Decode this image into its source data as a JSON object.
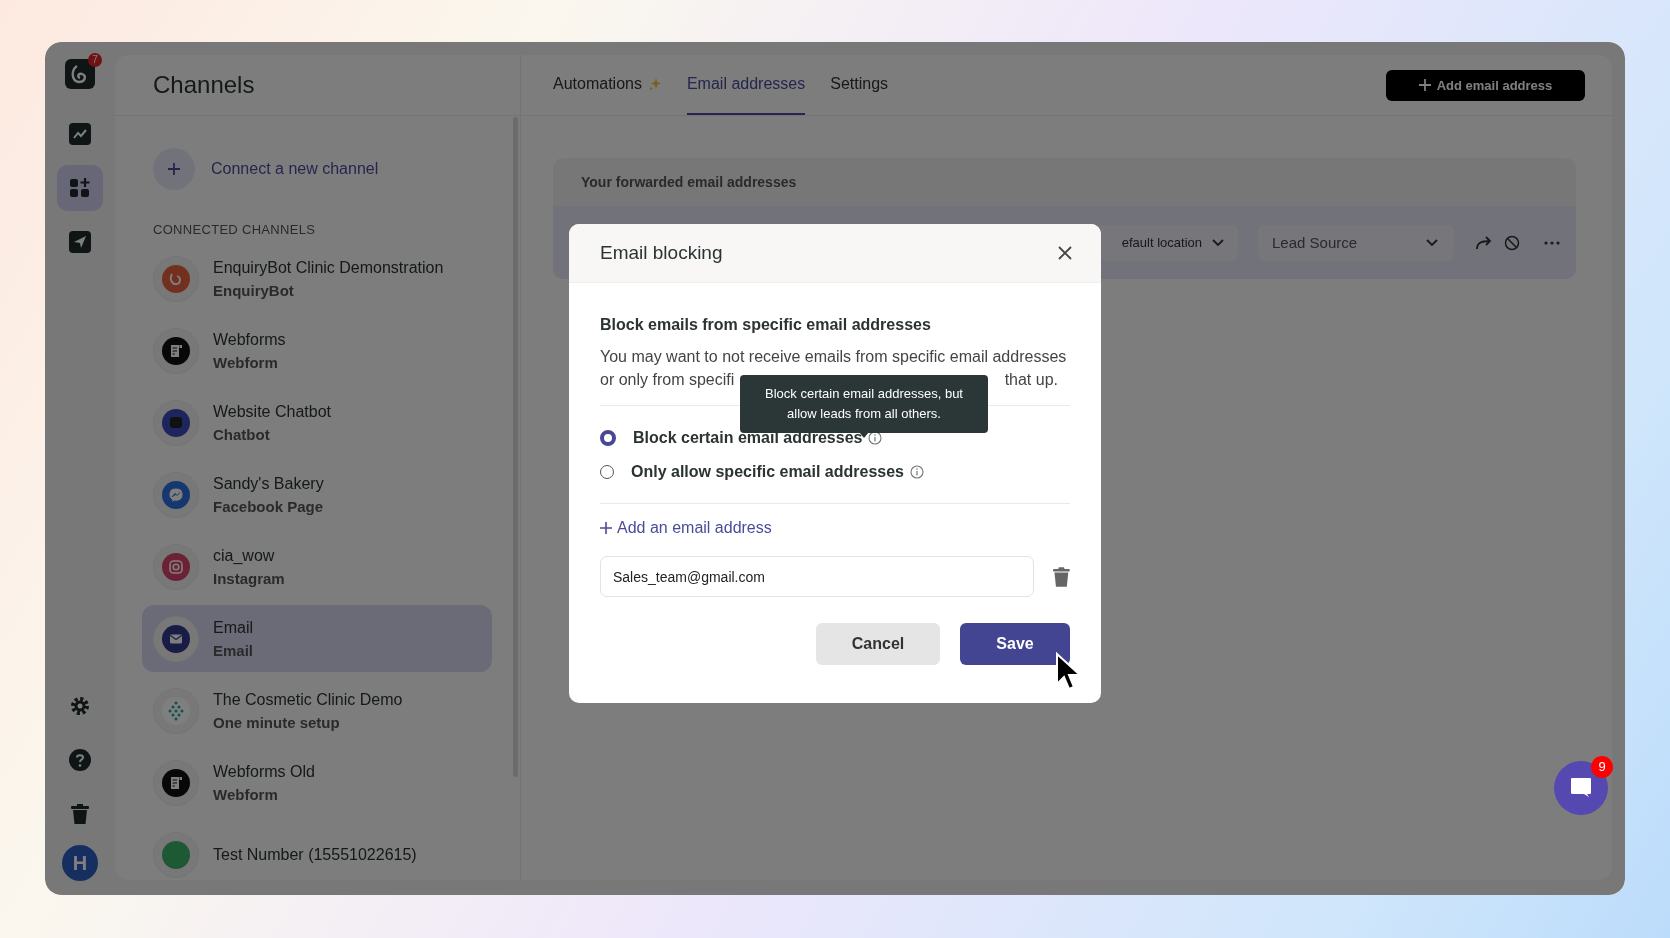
{
  "rail": {
    "logo_badge": "7",
    "items": [
      {
        "kind": "trend",
        "selected": false
      },
      {
        "kind": "apps",
        "selected": true
      },
      {
        "kind": "send",
        "selected": false
      }
    ],
    "bottom": [
      {
        "kind": "settings"
      },
      {
        "kind": "help"
      },
      {
        "kind": "trash"
      }
    ],
    "avatar": "H"
  },
  "channels": {
    "title": "Channels",
    "connect": "Connect a new channel",
    "section": "CONNECTED CHANNELS",
    "items": [
      {
        "name": "EnquiryBot Clinic Demonstration",
        "type": "EnquiryBot",
        "kind": "enquirybot",
        "selected": false
      },
      {
        "name": "Webforms",
        "type": "Webform",
        "kind": "webform",
        "selected": false
      },
      {
        "name": "Website Chatbot",
        "type": "Chatbot",
        "kind": "chatbot",
        "selected": false
      },
      {
        "name": "Sandy's Bakery",
        "type": "Facebook Page",
        "kind": "messenger",
        "selected": false
      },
      {
        "name": "cia_wow",
        "type": "Instagram",
        "kind": "instagram",
        "selected": false
      },
      {
        "name": "Email",
        "type": "Email",
        "kind": "email",
        "selected": true
      },
      {
        "name": "The Cosmetic Clinic Demo",
        "type": "One minute setup",
        "kind": "cosmetic",
        "selected": false
      },
      {
        "name": "Webforms Old",
        "type": "Webform",
        "kind": "webform",
        "selected": false
      },
      {
        "name": "Test Number (15551022615)",
        "kind": "phone",
        "selected": false
      }
    ]
  },
  "tabs": [
    {
      "label": "Automations",
      "kind": "sparkle",
      "selected": false
    },
    {
      "label": "Email addresses",
      "kind": "plain",
      "selected": true
    },
    {
      "label": "Settings",
      "kind": "plain",
      "selected": false
    }
  ],
  "add_button": "Add email address",
  "card": {
    "title": "Your forwarded email addresses",
    "location": "efault location",
    "lead_source": "Lead Source"
  },
  "modal": {
    "title": "Email blocking",
    "heading": "Block emails from specific email addresses",
    "description": [
      "You may want to not receive emails from specific email addresses",
      "or only from specifi",
      "that up."
    ],
    "tooltip": "Block certain email addresses, but allow leads from all others.",
    "options": [
      {
        "label": "Block certain email addresses",
        "selected": true
      },
      {
        "label": "Only allow specific email addresses",
        "selected": false
      }
    ],
    "add_link": "Add an email address",
    "email": "Sales_team@gmail.com",
    "cancel": "Cancel",
    "save": "Save"
  },
  "chat": {
    "badge": "9"
  }
}
